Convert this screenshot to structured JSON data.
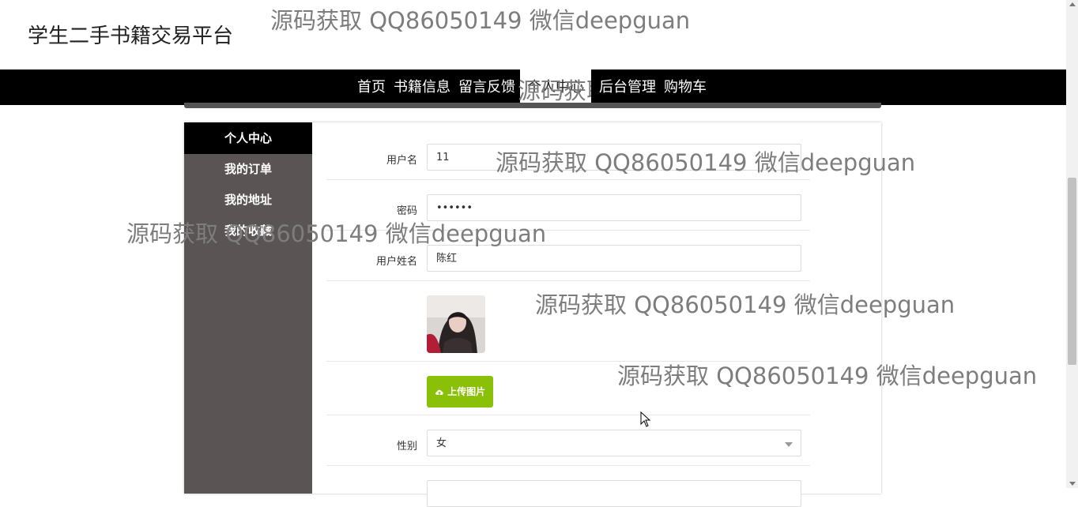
{
  "site": {
    "title": "学生二手书籍交易平台"
  },
  "nav": {
    "items": [
      {
        "label": "首页"
      },
      {
        "label": "书籍信息"
      },
      {
        "label": "留言反馈"
      },
      {
        "label": "个人中心",
        "active": true
      },
      {
        "label": "后台管理"
      },
      {
        "label": "购物车"
      }
    ]
  },
  "sidebar": {
    "items": [
      {
        "label": "个人中心",
        "active": true
      },
      {
        "label": "我的订单"
      },
      {
        "label": "我的地址"
      },
      {
        "label": "我的收藏"
      }
    ]
  },
  "form": {
    "username": {
      "label": "用户名",
      "value": "11"
    },
    "password": {
      "label": "密码",
      "value": "••••••"
    },
    "realname": {
      "label": "用户姓名",
      "value": "陈红"
    },
    "upload": {
      "label": "上传图片",
      "icon": "cloud-upload-icon"
    },
    "gender": {
      "label": "性别",
      "value": "女"
    }
  },
  "watermark": {
    "text": "源码获取 QQ86050149 微信deepguan"
  },
  "colors": {
    "navbar": "#000000",
    "sidebar": "#5a5455",
    "upload_button": "#8ac007"
  }
}
